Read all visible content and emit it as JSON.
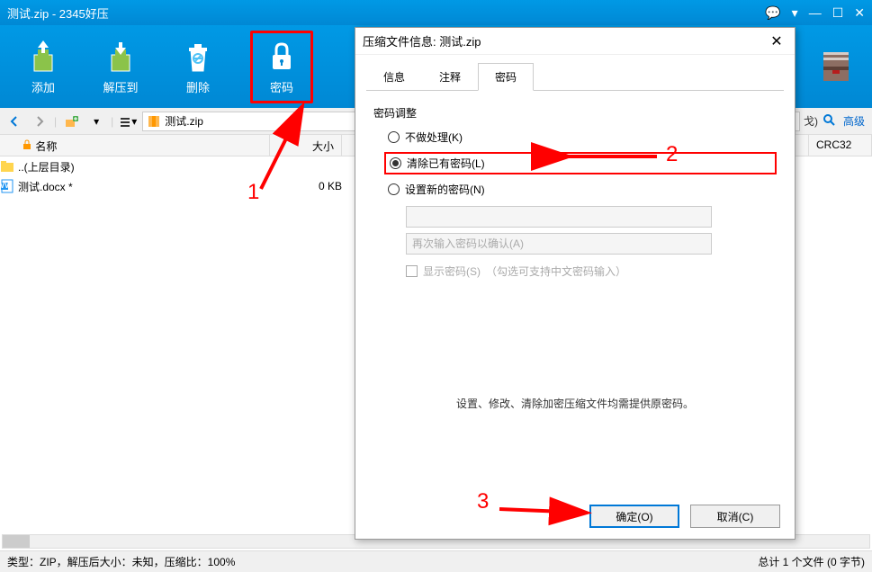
{
  "titlebar": {
    "title": "测试.zip - 2345好压"
  },
  "toolbar": {
    "add": "添加",
    "extract": "解压到",
    "delete": "删除",
    "password": "密码"
  },
  "navbar": {
    "path": "测试.zip",
    "right_hint": "戈)",
    "advanced": "高级"
  },
  "filelist": {
    "headers": {
      "name": "名称",
      "size": "大小",
      "crc": "CRC32"
    },
    "rows": [
      {
        "name": "..(上层目录)",
        "size": "",
        "type": "up"
      },
      {
        "name": "测试.docx *",
        "size": "0 KB",
        "type": "docx"
      }
    ]
  },
  "dialog": {
    "title": "压缩文件信息: 测试.zip",
    "tabs": {
      "info": "信息",
      "comment": "注释",
      "password": "密码"
    },
    "pwd_section": "密码调整",
    "radio1": "不做处理(K)",
    "radio2": "清除已有密码(L)",
    "radio3": "设置新的密码(N)",
    "placeholder2": "再次输入密码以确认(A)",
    "show_pwd": "显示密码(S)",
    "show_pwd_hint": "（勾选可支持中文密码输入）",
    "hint": "设置、修改、清除加密压缩文件均需提供原密码。",
    "ok": "确定(O)",
    "cancel": "取消(C)"
  },
  "statusbar": {
    "left": "类型：ZIP，解压后大小：未知，压缩比：100%",
    "right": "总计 1 个文件 (0 字节)"
  },
  "annotations": {
    "n1": "1",
    "n2": "2",
    "n3": "3"
  }
}
